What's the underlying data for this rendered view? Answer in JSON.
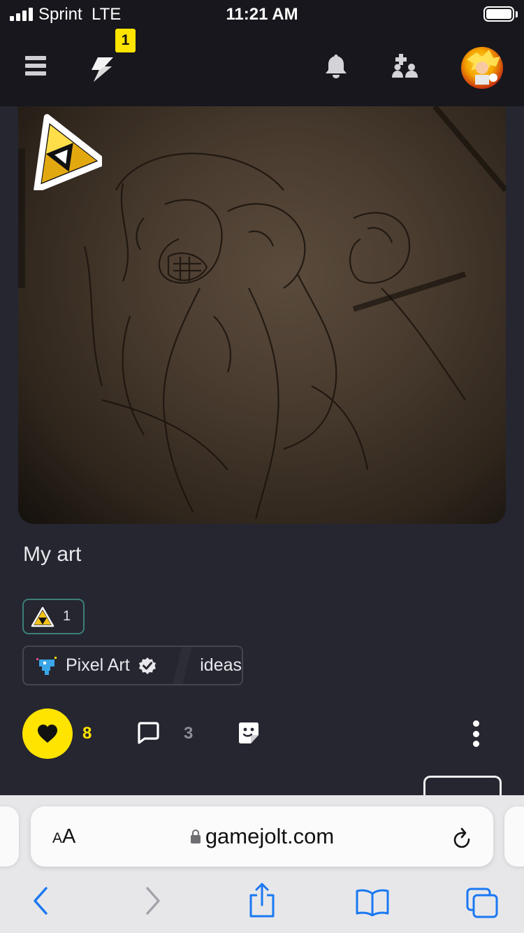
{
  "status_bar": {
    "carrier": "Sprint",
    "network": "LTE",
    "time": "11:21 AM"
  },
  "nav": {
    "notification_badge": "1",
    "icons": [
      "menu-icon",
      "jolt-bolt-icon",
      "bell-icon",
      "friends-icon",
      "avatar"
    ]
  },
  "post": {
    "text": "My art",
    "reaction": {
      "icon": "triforce-sticker-icon",
      "count": "1"
    },
    "community": {
      "name": "Pixel Art",
      "verified": true,
      "channel": "ideas"
    },
    "likes": "8",
    "comments": "3"
  },
  "browser": {
    "text_size_label_small": "A",
    "text_size_label_big": "A",
    "url": "gamejolt.com"
  },
  "colors": {
    "accent_yellow": "#ffe400",
    "nav_bg": "#17171d",
    "page_bg": "#252630",
    "teal_border": "#3d7f77",
    "ios_blue": "#1a78f2"
  }
}
